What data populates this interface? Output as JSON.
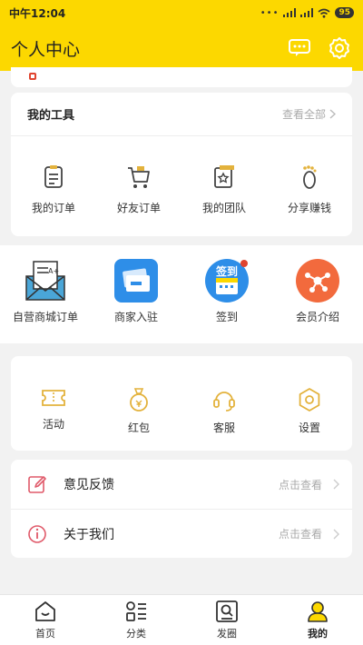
{
  "status": {
    "time": "中午12:04",
    "dots": "•••",
    "battery": "95"
  },
  "header": {
    "title": "个人中心",
    "message_icon": "message-icon",
    "settings_icon": "gear-icon"
  },
  "tools": {
    "title": "我的工具",
    "more": "查看全部",
    "items": [
      {
        "label": "我的订单",
        "icon": "order-icon"
      },
      {
        "label": "好友订单",
        "icon": "cart-icon"
      },
      {
        "label": "我的团队",
        "icon": "team-icon"
      },
      {
        "label": "分享赚钱",
        "icon": "footprint-icon"
      }
    ]
  },
  "strip": {
    "items": [
      {
        "label": "自营商城订单",
        "icon": "envelope-icon"
      },
      {
        "label": "商家入驻",
        "icon": "merchant-icon"
      },
      {
        "label": "签到",
        "icon": "checkin-icon",
        "badge": "签到"
      },
      {
        "label": "会员介绍",
        "icon": "member-icon"
      }
    ]
  },
  "services": {
    "items": [
      {
        "label": "活动",
        "icon": "ticket-icon"
      },
      {
        "label": "红包",
        "icon": "redpacket-icon"
      },
      {
        "label": "客服",
        "icon": "headset-icon"
      },
      {
        "label": "设置",
        "icon": "hexagon-icon"
      }
    ]
  },
  "list": {
    "items": [
      {
        "label": "意见反馈",
        "hint": "点击查看",
        "icon": "edit-icon"
      },
      {
        "label": "关于我们",
        "hint": "点击查看",
        "icon": "info-icon"
      }
    ]
  },
  "tabbar": {
    "items": [
      {
        "label": "首页",
        "icon": "home-icon"
      },
      {
        "label": "分类",
        "icon": "category-icon"
      },
      {
        "label": "发圈",
        "icon": "moments-icon"
      },
      {
        "label": "我的",
        "icon": "profile-icon",
        "active": true
      }
    ]
  },
  "colors": {
    "brand": "#fcd800",
    "accent_icon": "#e3b23c",
    "list_icon": "#e05a6a",
    "tab_active": "#fcd800"
  }
}
